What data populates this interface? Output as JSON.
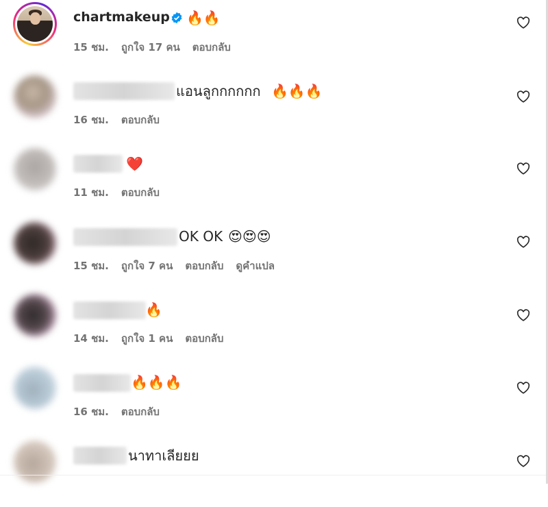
{
  "post_owner": {
    "username": "chartmakeup",
    "verified": true,
    "reaction_emoji": "🔥🔥",
    "time": "15 ชม.",
    "likes": "ถูกใจ 17 คน",
    "reply": "ตอบกลับ"
  },
  "comments": [
    {
      "text": "แอนลูกกกกกก",
      "emoji": "🔥🔥🔥",
      "time": "16 ชม.",
      "reply": "ตอบกลับ"
    },
    {
      "text": "",
      "emoji": "❤️",
      "time": "11 ชม.",
      "reply": "ตอบกลับ"
    },
    {
      "text": "OK OK",
      "emoji": "😍😍😍",
      "time": "15 ชม.",
      "likes": "ถูกใจ 7 คน",
      "reply": "ตอบกลับ",
      "translate": "ดูคำแปล"
    },
    {
      "text": "",
      "emoji": "🔥",
      "time": "14 ชม.",
      "likes": "ถูกใจ 1 คน",
      "reply": "ตอบกลับ"
    },
    {
      "text": "",
      "emoji": "🔥🔥🔥",
      "time": "16 ชม.",
      "reply": "ตอบกลับ"
    },
    {
      "text": "นาทาเลียยย",
      "emoji": "",
      "time": "",
      "reply": ""
    }
  ],
  "colors": {
    "text": "#262626",
    "meta": "#737373",
    "verified_badge": "#0095f6"
  },
  "icons": {
    "like": "heart-outline-icon",
    "verified": "verified-badge-icon"
  }
}
